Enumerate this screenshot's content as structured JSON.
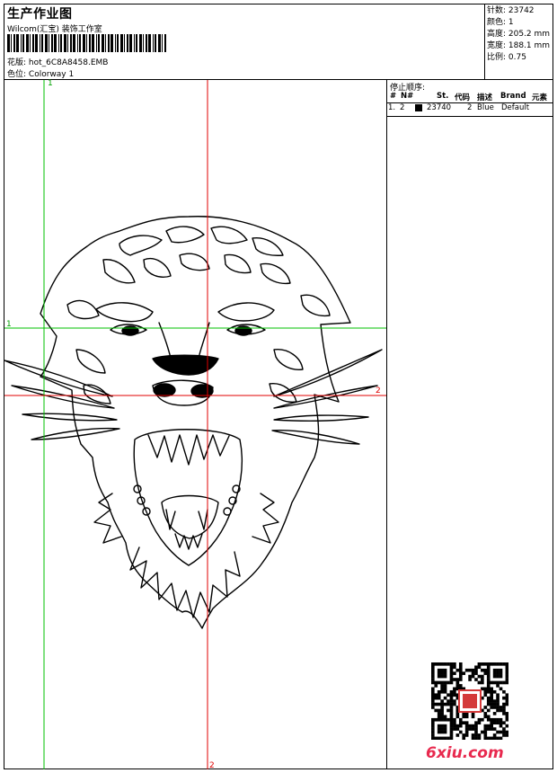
{
  "header": {
    "title": "生产作业图",
    "subtitle": "Wilcom(汇宝) 装饰工作室",
    "design_label": "花版:",
    "design_value": "hot_6C8A8458.EMB",
    "colorway_label": "色位:",
    "colorway_value": "Colorway 1"
  },
  "stats": {
    "stitches": "针数: 23742",
    "colors": "颜色: 1",
    "height": "高度: 205.2 mm",
    "width": "宽度: 188.1 mm",
    "scale": "比例: 0.75"
  },
  "stop_sequence": {
    "title": "停止顺序:",
    "headers": [
      "#",
      "N#",
      "St.",
      "代码",
      "描述",
      "Brand",
      "元素"
    ],
    "rows": [
      {
        "index": "1.",
        "needle": "2",
        "stitches": "23740",
        "code": "2",
        "desc": "Blue",
        "brand": "Default",
        "swatch": "#000000"
      }
    ]
  },
  "guides": {
    "v1_top": "1",
    "h1_left": "1",
    "h2_right": "2",
    "v2_bottom": "2"
  },
  "watermark": {
    "brand": "6xiu.com",
    "brand_color": "#e8294e"
  }
}
